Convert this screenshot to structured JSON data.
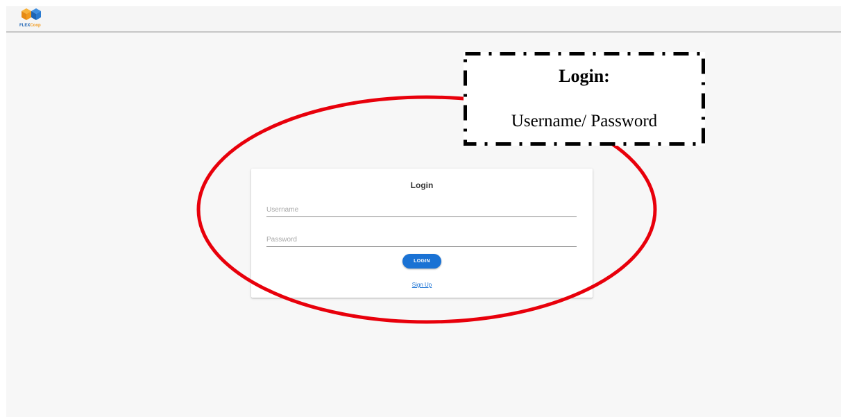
{
  "header": {
    "logo": {
      "icon": "cube-logo-icon",
      "text_flex": "FLEX",
      "text_coop": "Coop"
    }
  },
  "login_card": {
    "title": "Login",
    "username_placeholder": "Username",
    "password_placeholder": "Password",
    "login_button_label": "LOGIN",
    "signup_link_label": "Sign Up"
  },
  "annotation": {
    "callout_title": "Login:",
    "callout_body": "Username/ Password",
    "ellipse_color": "#e8000b"
  },
  "colors": {
    "primary": "#1a72d4",
    "logo_blue": "#1e64b4",
    "logo_orange": "#f29a1d",
    "background": "#f7f7f7"
  }
}
